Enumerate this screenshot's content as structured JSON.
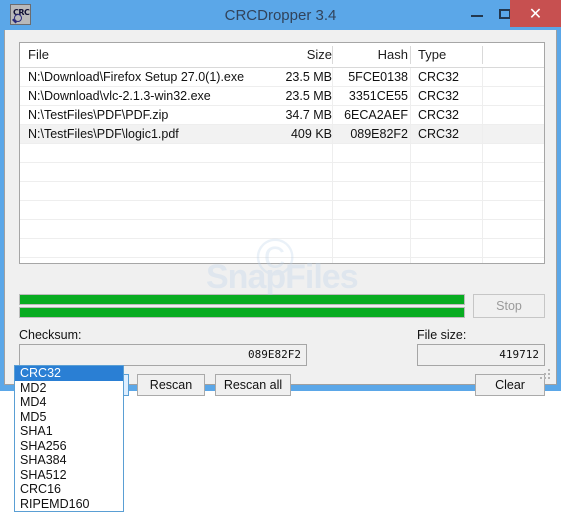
{
  "window": {
    "title": "CRCDropper 3.4",
    "icon_name": "crc-app-icon",
    "icon_text": "CRC",
    "controls": {
      "minimize": "–",
      "maximize": "□",
      "close": "✕"
    },
    "accent_color": "#5ba7e8",
    "close_color": "#c75050"
  },
  "file_list": {
    "columns": [
      "File",
      "Size",
      "Hash",
      "Type"
    ],
    "rows": [
      {
        "file": "N:\\Download\\Firefox Setup 27.0(1).exe",
        "size": "23.5 MB",
        "hash": "5FCE0138",
        "type": "CRC32",
        "selected": false
      },
      {
        "file": "N:\\Download\\vlc-2.1.3-win32.exe",
        "size": "23.5 MB",
        "hash": "3351CE55",
        "type": "CRC32",
        "selected": false
      },
      {
        "file": "N:\\TestFiles\\PDF\\PDF.zip",
        "size": "34.7 MB",
        "hash": "6ECA2AEF",
        "type": "CRC32",
        "selected": false
      },
      {
        "file": "N:\\TestFiles\\PDF\\logic1.pdf",
        "size": "409 KB",
        "hash": "089E82F2",
        "type": "CRC32",
        "selected": true
      }
    ],
    "empty_row_count": 10
  },
  "progress": {
    "file_percent": 100,
    "total_percent": 100,
    "fill_color": "#08ac21"
  },
  "buttons": {
    "stop": "Stop",
    "stop_enabled": false,
    "rescan": "Rescan",
    "rescan_all": "Rescan all",
    "clear": "Clear"
  },
  "checksum": {
    "label": "Checksum:",
    "value": "089E82F2"
  },
  "file_size": {
    "label": "File size:",
    "value": "419712"
  },
  "algorithm": {
    "selected": "CRC32",
    "chevron": "⌄",
    "options": [
      "CRC32",
      "MD2",
      "MD4",
      "MD5",
      "SHA1",
      "SHA256",
      "SHA384",
      "SHA512",
      "CRC16",
      "RIPEMD160"
    ],
    "expanded": true
  },
  "watermark": {
    "symbol": "©",
    "text": "SnapFiles"
  }
}
